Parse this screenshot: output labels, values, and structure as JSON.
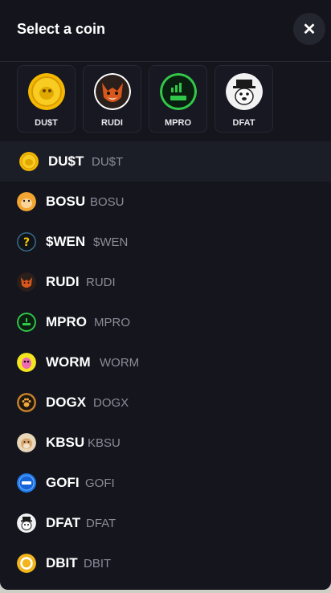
{
  "header": {
    "title": "Select a coin",
    "close_icon": "close-icon"
  },
  "favorites": [
    {
      "label": "DU$T",
      "icon": "dust-coin-icon"
    },
    {
      "label": "RUDI",
      "icon": "rudi-fox-icon"
    },
    {
      "label": "MPRO",
      "icon": "mpro-icon"
    },
    {
      "label": "DFAT",
      "icon": "dfat-icon"
    }
  ],
  "coins": [
    {
      "symbol": "DU$T",
      "name": "DU$T",
      "icon": "dust-coin-icon",
      "selected": true
    },
    {
      "symbol": "BOSU",
      "name": "BOSU",
      "icon": "bosu-dog-icon"
    },
    {
      "symbol": "$WEN",
      "name": "$WEN",
      "icon": "wen-question-icon"
    },
    {
      "symbol": "RUDI",
      "name": "RUDI",
      "icon": "rudi-fox-icon"
    },
    {
      "symbol": "MPRO",
      "name": "MPRO",
      "icon": "mpro-icon"
    },
    {
      "symbol": "WORM",
      "name": "WORM",
      "icon": "worm-icon"
    },
    {
      "symbol": "DOGX",
      "name": "DOGX",
      "icon": "dogx-paw-icon"
    },
    {
      "symbol": "KBSU",
      "name": "KBSU",
      "icon": "kbsu-dog-icon"
    },
    {
      "symbol": "GOFI",
      "name": "GOFI",
      "icon": "gofi-icon"
    },
    {
      "symbol": "DFAT",
      "name": "DFAT",
      "icon": "dfat-icon"
    },
    {
      "symbol": "DBIT",
      "name": "DBIT",
      "icon": "dbit-icon"
    }
  ],
  "colors": {
    "background": "#14151d",
    "selected_row": "#1c1e27",
    "text_primary": "#ffffff",
    "text_secondary": "#8a8c98"
  }
}
